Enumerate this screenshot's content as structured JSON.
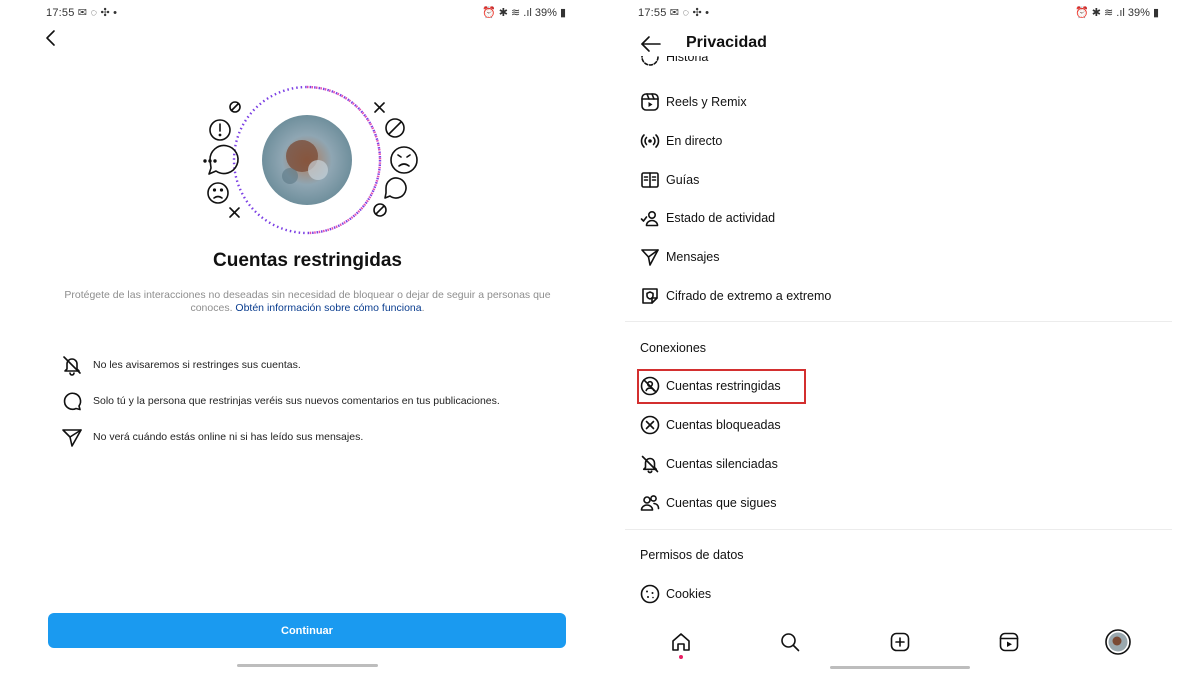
{
  "status_bar": {
    "left_time": "17:55",
    "left_battery": "39%",
    "right_time": "17:55",
    "right_battery": "39%"
  },
  "left_screen": {
    "title": "Cuentas restringidas",
    "description": "Protégete de las interacciones no deseadas sin necesidad de bloquear o dejar de seguir a personas que conoces.",
    "description_link": "Obtén información sobre cómo funciona",
    "description_end": ".",
    "features": [
      {
        "icon": "bell-off-icon",
        "text": "No les avisaremos si restringes sus cuentas."
      },
      {
        "icon": "comment-bubble-icon",
        "text": "Solo tú y la persona que restrinjas veréis sus nuevos comentarios en tus publicaciones."
      },
      {
        "icon": "direct-message-icon",
        "text": "No verá cuándo estás online ni si has leído sus mensajes."
      }
    ],
    "continue_label": "Continuar"
  },
  "right_screen": {
    "title": "Privacidad",
    "partial_item": "Historia",
    "items_top": [
      {
        "icon": "reels-icon",
        "label": "Reels y Remix"
      },
      {
        "icon": "live-icon",
        "label": "En directo"
      },
      {
        "icon": "guides-icon",
        "label": "Guías"
      },
      {
        "icon": "activity-status-icon",
        "label": "Estado de actividad"
      },
      {
        "icon": "messages-icon",
        "label": "Mensajes"
      },
      {
        "icon": "e2e-encryption-icon",
        "label": "Cifrado de extremo a extremo"
      }
    ],
    "connections_header": "Conexiones",
    "connections": [
      {
        "icon": "restricted-icon",
        "label": "Cuentas restringidas"
      },
      {
        "icon": "blocked-icon",
        "label": "Cuentas bloqueadas"
      },
      {
        "icon": "muted-icon",
        "label": "Cuentas silenciadas"
      },
      {
        "icon": "following-icon",
        "label": "Cuentas que sigues"
      }
    ],
    "data_header": "Permisos de datos",
    "data_items": [
      {
        "icon": "cookies-icon",
        "label": "Cookies"
      }
    ],
    "bottom_nav": [
      "home-icon",
      "search-icon",
      "create-icon",
      "reels-tab-icon",
      "profile-avatar"
    ]
  },
  "colors": {
    "accent_blue": "#1a9af0",
    "link_blue": "#0a3d8f",
    "highlight_red": "#d32f2f",
    "notification_dot": "#e91e63"
  }
}
